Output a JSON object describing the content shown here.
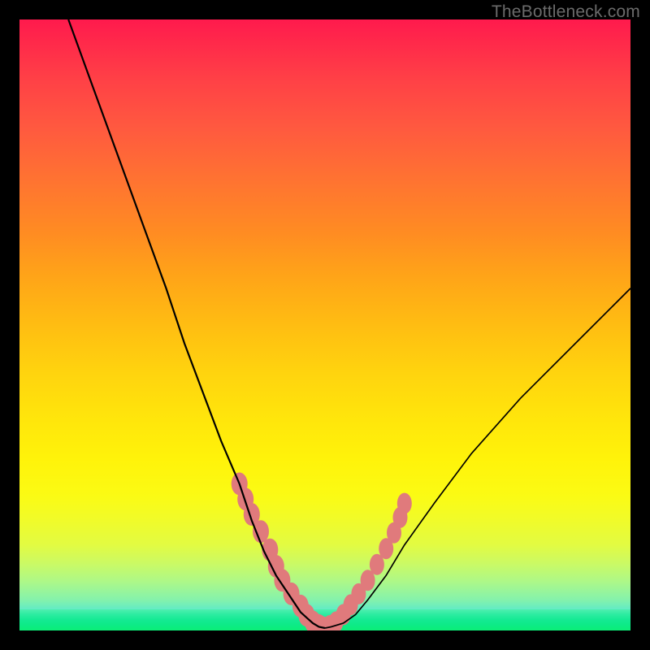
{
  "watermark": "TheBottleneck.com",
  "colors": {
    "frame": "#000000",
    "curve": "#000000",
    "blob_fill": "#e07a7c",
    "blob_stroke": "#d96f72"
  },
  "chart_data": {
    "type": "line",
    "title": "",
    "xlabel": "",
    "ylabel": "",
    "xlim": [
      0,
      100
    ],
    "ylim": [
      0,
      100
    ],
    "description": "Two curved lines descending from the top into a narrow valley near the bottom center, with salmon-colored blobs on both curves where they approach the valley.",
    "series": [
      {
        "name": "left-curve",
        "x": [
          8,
          12,
          16,
          20,
          24,
          27,
          30,
          33,
          36,
          38,
          40,
          42,
          44,
          46,
          48,
          49,
          50
        ],
        "y": [
          100,
          89,
          78,
          67,
          56,
          47,
          39,
          31,
          24,
          18,
          13,
          9,
          6,
          3,
          1.2,
          0.6,
          0.4
        ]
      },
      {
        "name": "right-curve",
        "x": [
          50,
          51,
          53,
          55,
          57,
          60,
          63,
          68,
          74,
          82,
          92,
          100
        ],
        "y": [
          0.4,
          0.6,
          1.2,
          2.6,
          5,
          9,
          14,
          21,
          29,
          38,
          48,
          56
        ]
      }
    ],
    "blobs_left": {
      "x": [
        36,
        37,
        38,
        39.5,
        41,
        42,
        43,
        44.5,
        46,
        47,
        48,
        49,
        49.5
      ],
      "y": [
        24,
        21.5,
        19,
        16.2,
        13.2,
        10.5,
        8.2,
        6,
        4,
        2.5,
        1.4,
        0.8,
        0.5
      ]
    },
    "blobs_right": {
      "x": [
        50,
        50.8,
        51.8,
        53,
        54.2,
        55.5,
        57,
        58.5,
        60,
        61.3,
        62.3,
        63
      ],
      "y": [
        0.5,
        0.8,
        1.4,
        2.6,
        4.2,
        6,
        8.2,
        10.8,
        13.4,
        16,
        18.5,
        20.8
      ]
    }
  }
}
